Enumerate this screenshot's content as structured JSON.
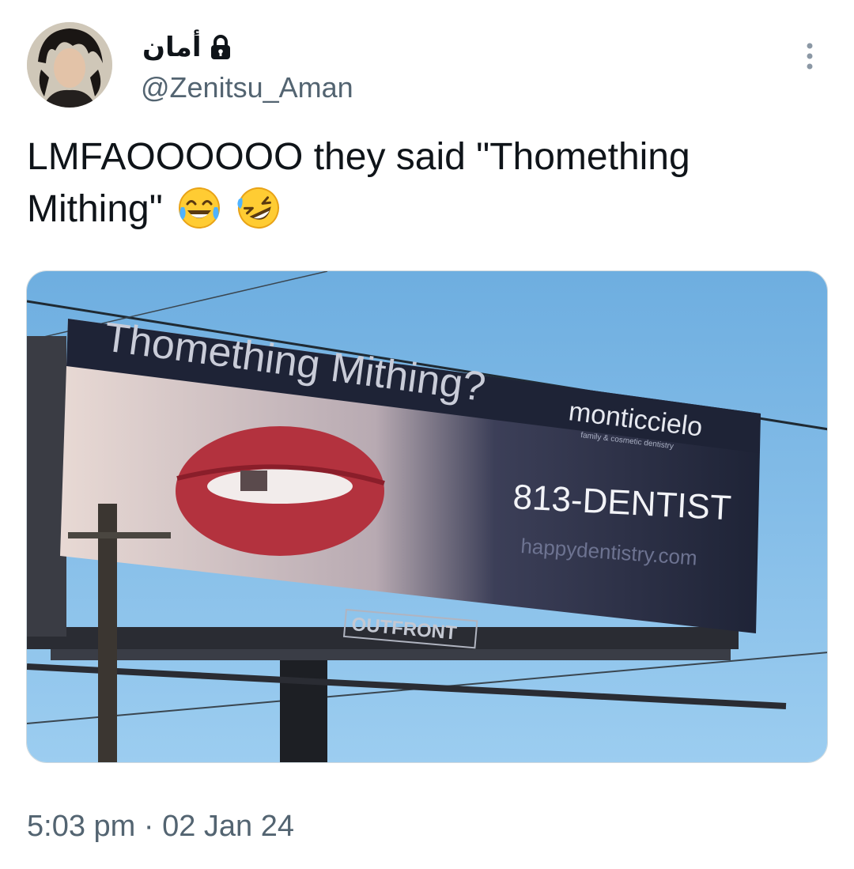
{
  "tweet": {
    "author_name": "أمان",
    "handle": "@Zenitsu_Aman",
    "text": "LMFAOOOOOO they said \"Thomething Mithing\"",
    "emojis": [
      "tears-of-joy-emoji",
      "rolling-on-floor-laughing-emoji"
    ],
    "timestamp": "5:03 pm · 02 Jan 24"
  },
  "media": {
    "billboard_headline": "Thomething Mithing?",
    "brand": "monticcielo",
    "brand_tagline": "family & cosmetic dentistry",
    "phone": "813-DENTIST",
    "website": "happydentistry.com",
    "operator": "OUTFRONT"
  },
  "icons": {
    "lock": "lock-icon",
    "more": "more-vertical-icon"
  },
  "colors": {
    "text_primary": "#0f1419",
    "text_secondary": "#536471",
    "sky": "#7fb8e4",
    "billboard_dark": "#1e2336"
  }
}
